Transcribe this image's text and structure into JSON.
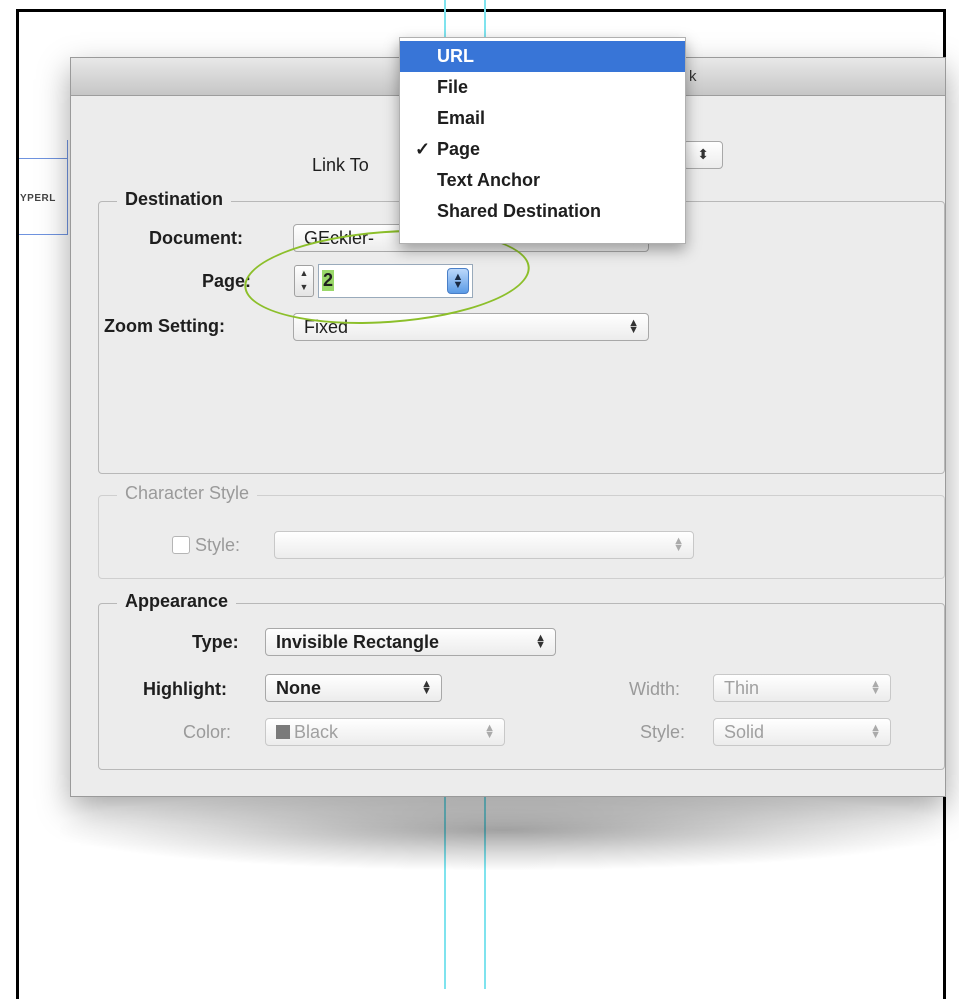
{
  "background": {
    "panel_label": "YPERL"
  },
  "dialog": {
    "title_fragment": "k",
    "link_to": {
      "label": "Link To",
      "value_arrow": "⬍"
    },
    "menu": {
      "items": [
        {
          "label": "URL",
          "selected": true,
          "checked": false
        },
        {
          "label": "File",
          "selected": false,
          "checked": false
        },
        {
          "label": "Email",
          "selected": false,
          "checked": false
        },
        {
          "label": "Page",
          "selected": false,
          "checked": true
        },
        {
          "label": "Text Anchor",
          "selected": false,
          "checked": false
        },
        {
          "label": "Shared Destination",
          "selected": false,
          "checked": false
        }
      ],
      "check_glyph": "✓"
    },
    "destination": {
      "legend": "Destination",
      "document_label": "Document:",
      "document_value": "GEckler-",
      "page_label": "Page:",
      "page_value": "2",
      "zoom_label": "Zoom Setting:",
      "zoom_value": "Fixed"
    },
    "character_style": {
      "legend": "Character Style",
      "style_label": "Style:",
      "style_value": ""
    },
    "appearance": {
      "legend": "Appearance",
      "type_label": "Type:",
      "type_value": "Invisible Rectangle",
      "highlight_label": "Highlight:",
      "highlight_value": "None",
      "color_label": "Color:",
      "color_value": "Black",
      "width_label": "Width:",
      "width_value": "Thin",
      "style_label": "Style:",
      "style_value": "Solid"
    }
  },
  "colors": {
    "menu_highlight": "#3875d7",
    "annotation_ellipse": "#8cbf2a",
    "page_value_highlight": "#9ad86a",
    "guide_line": "#7fe3ee"
  }
}
